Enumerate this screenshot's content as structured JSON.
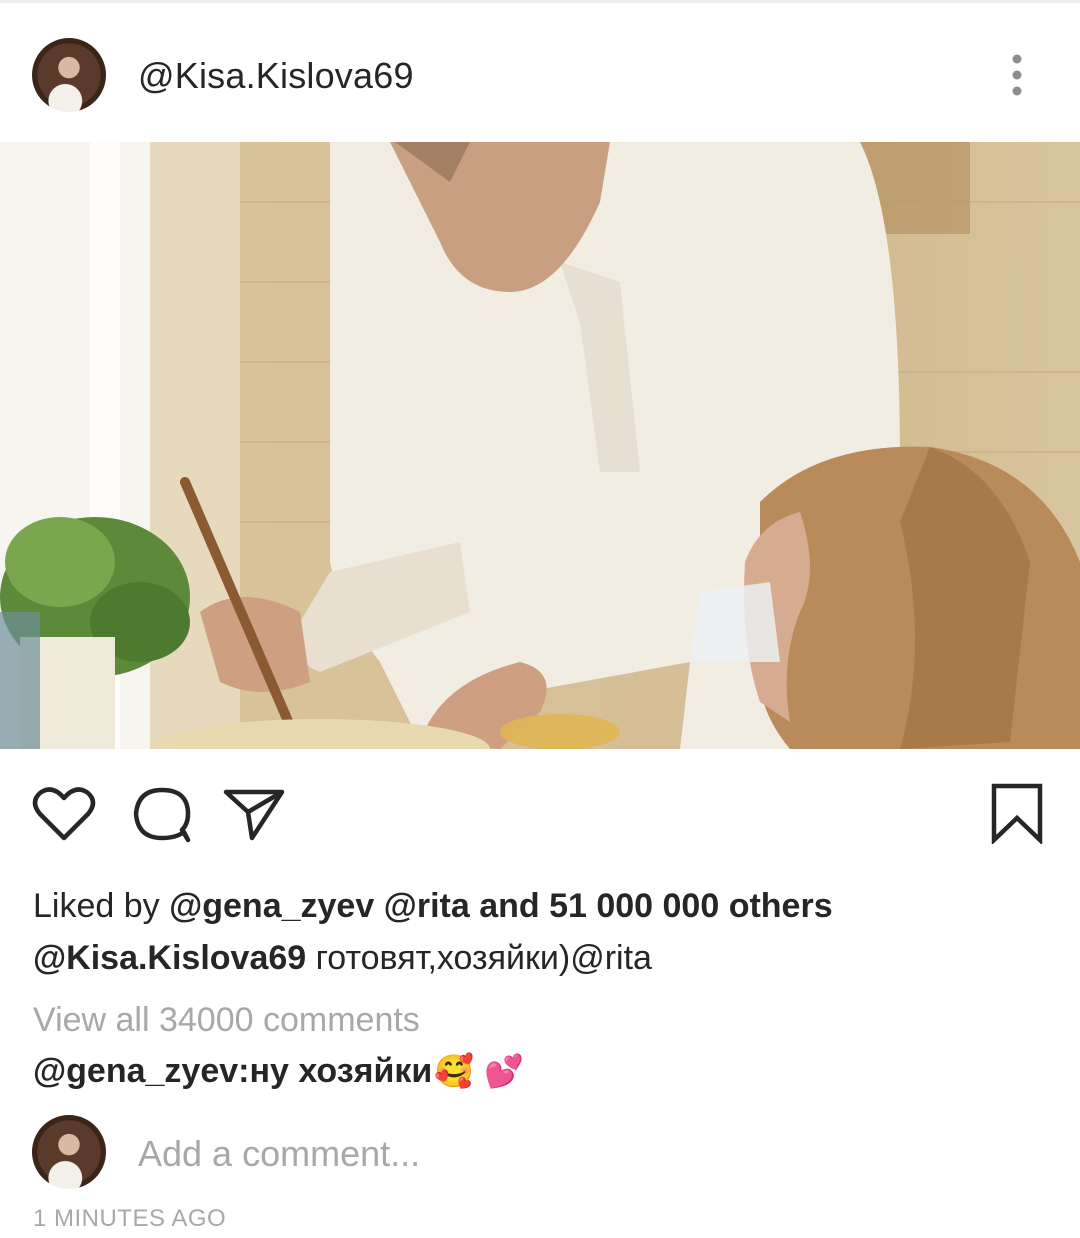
{
  "header": {
    "username": "@Kisa.Kislova69",
    "avatar_icon": "user-avatar",
    "more_icon": "more-vertical-icon"
  },
  "photo": {
    "icon": "post-photo"
  },
  "actions": {
    "like_icon": "heart-icon",
    "comment_icon": "comment-icon",
    "share_icon": "send-icon",
    "save_icon": "bookmark-icon"
  },
  "likes": {
    "prefix": "Liked by ",
    "names_and_count": "@gena_zyev @rita and 51 000 000 others"
  },
  "caption": {
    "author": "@Kisa.Kislova69",
    "text": " готовят,хозяйки)@rita"
  },
  "view_all_comments": "View all 34000 comments",
  "comment": {
    "text": "@gena_zyev:ну хозяйки",
    "emoji": "🥰 💕"
  },
  "add_comment": {
    "placeholder": "Add a comment..."
  },
  "timestamp": "1 MINUTES AGO",
  "colors": {
    "text": "#262626",
    "muted": "#a8a8a8",
    "background": "#ffffff"
  }
}
